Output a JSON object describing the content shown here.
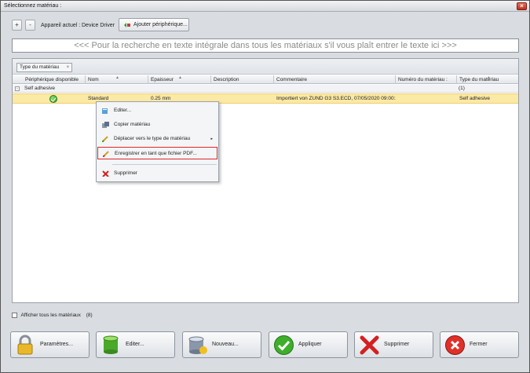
{
  "window": {
    "title": "Sélectionnez matériau :",
    "close_glyph": "×"
  },
  "toolbar": {
    "plus_glyph": "+",
    "minus_glyph": "-",
    "current_device_label": "Appareil actuel :",
    "current_device_value": "Device Driver",
    "add_device_label": "Ajouter périphérique..."
  },
  "search": {
    "placeholder": "<<< Pour la recherche en texte intégrale dans tous les matériaux s'il vous plaît entrer le texte ici >>>"
  },
  "grid": {
    "group_chip": "Type du matériau",
    "group_chip_close": "×",
    "columns": [
      "Périphérique disponible",
      "Nom",
      "Epaisseur",
      "Description",
      "Commentaire",
      "Numéro du matériau :",
      "Type du matériau"
    ],
    "group": {
      "expander": "-",
      "name": "Self adhesive",
      "count": "(1)"
    },
    "rows": [
      {
        "name": "Standard",
        "thickness": "0.25 mm",
        "description": "",
        "comment": "Importiert von ZUND G3 S3.ECD, 07/05/2020 09:00:27",
        "number": "",
        "type": "Self adhesive"
      }
    ]
  },
  "context_menu": {
    "items": [
      {
        "label": "Editer...",
        "icon": "edit-icon"
      },
      {
        "label": "Copier matériau",
        "icon": "copy-icon"
      },
      {
        "label": "Déplacer vers le type de matériau",
        "icon": "move-icon",
        "submenu": true,
        "arrow": "▸"
      },
      {
        "label": "Enregistrer en tant que fichier PDF...",
        "icon": "pdf-icon",
        "highlighted": true
      },
      {
        "label": "Supprimer",
        "icon": "delete-icon"
      }
    ]
  },
  "footer": {
    "show_all_label": "Afficher tous les matériaux",
    "show_all_count": "(8)",
    "buttons": [
      "Paramètres...",
      "Editer...",
      "Nouveau...",
      "Appliquer",
      "Supprimer",
      "Fermer"
    ]
  },
  "colors": {
    "selected_row": "#fbe9a6",
    "highlight_border": "#e0252a",
    "accent_green": "#2f9a1e"
  }
}
